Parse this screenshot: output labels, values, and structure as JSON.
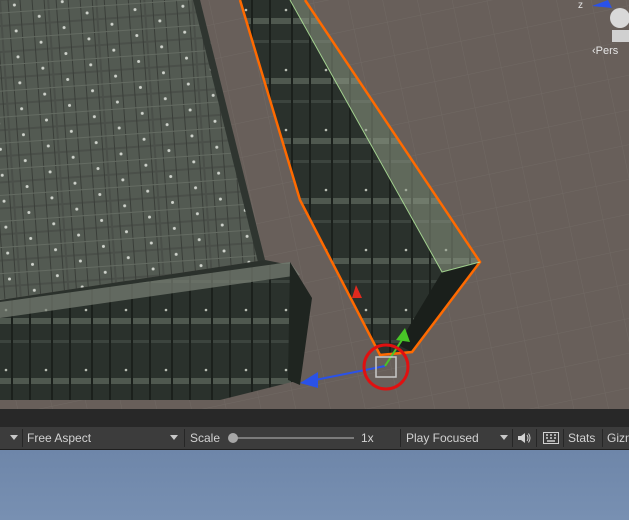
{
  "scene_view": {
    "gizmo_axis_label": "z",
    "projection_label": "‹Pers",
    "colors": {
      "background": "#685f5a",
      "selection_outline": "#ff6a00",
      "x_axis": "#e02a1f",
      "y_axis": "#48c427",
      "z_axis": "#2a52e8",
      "annotation_circle": "#e01010"
    }
  },
  "game_toolbar": {
    "aspect_dropdown": "Free Aspect",
    "scale_label": "Scale",
    "scale_value": "1x",
    "play_mode_dropdown": "Play Focused",
    "audio_icon": "speaker-icon",
    "keyboard_icon": "keyboard-icon",
    "stats_button": "Stats",
    "gizmos_button": "Gizm"
  }
}
